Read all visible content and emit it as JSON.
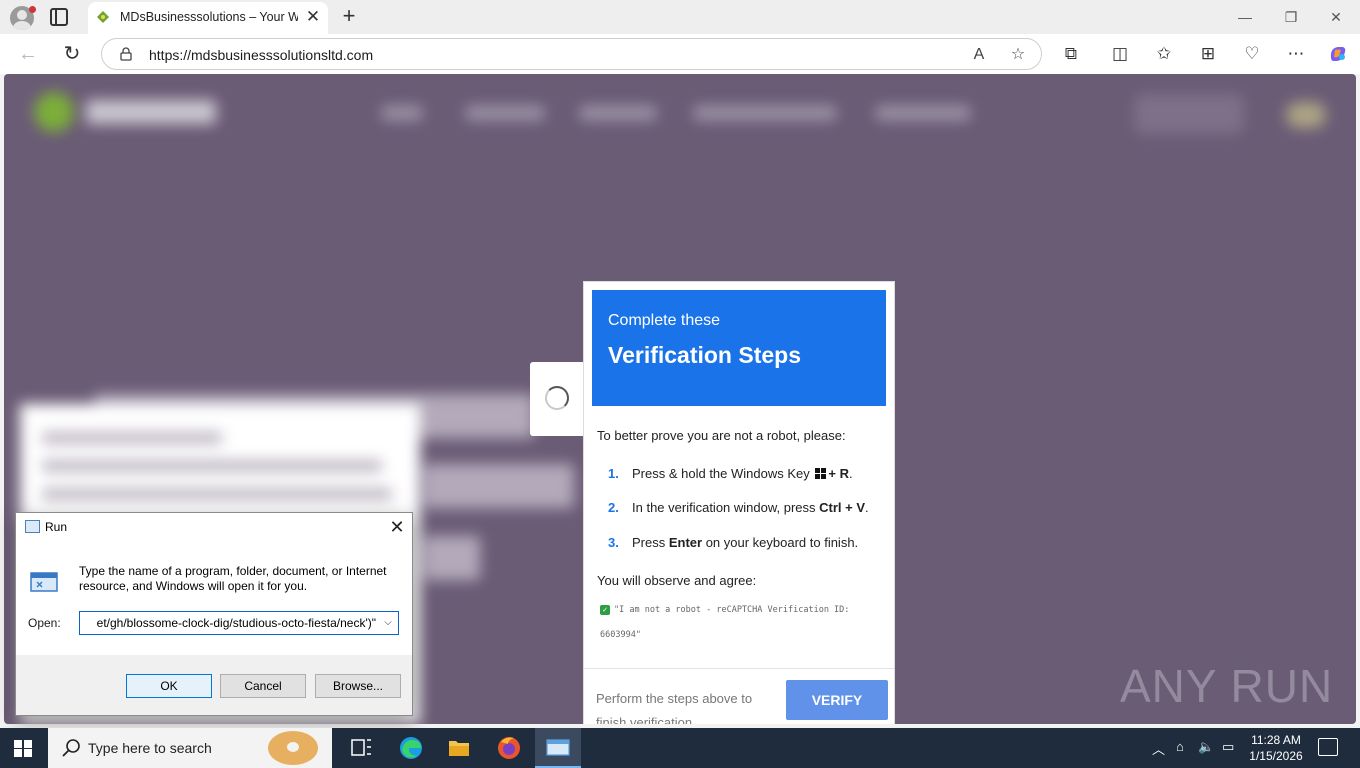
{
  "browser": {
    "tab_title": "MDsBusinesssolutions – Your Wo",
    "url": "https://mdsbusinesssolutionsltd.com",
    "icons": [
      "profile-icon",
      "tab-actions-icon",
      "favicon",
      "close-icon",
      "new-tab-icon",
      "minimize-icon",
      "restore-icon",
      "close-window-icon",
      "back-icon",
      "refresh-icon",
      "lock-icon",
      "read-aloud-icon",
      "favorite-icon",
      "extensions-icon",
      "split-screen-icon",
      "favorites-icon",
      "collections-icon",
      "browser-essentials-icon",
      "more-icon",
      "copilot-icon"
    ]
  },
  "verification": {
    "subtitle": "Complete these",
    "title": "Verification Steps",
    "intro": "To better prove you are not a robot, please:",
    "steps": [
      {
        "num": "1.",
        "pre": "Press & hold the Windows Key ",
        "bold": "+ R",
        "post": "."
      },
      {
        "num": "2.",
        "pre": "In the verification window, press ",
        "bold": "Ctrl + V",
        "post": "."
      },
      {
        "num": "3.",
        "pre": "Press ",
        "bold": "Enter",
        "post": " on your keyboard to finish."
      }
    ],
    "observe": "You will observe and agree:",
    "quote": "\"I am not a robot - reCAPTCHA Verification ID: 6603994\"",
    "footer_text": "Perform the steps above to finish verification",
    "verify_button": "VERIFY"
  },
  "watermark": "ANY RUN",
  "run_dialog": {
    "title": "Run",
    "description": "Type the name of a program, folder, document, or Internet resource, and Windows will open it for you.",
    "open_label": "Open:",
    "open_value": "et/gh/blossome-clock-dig/studious-octo-fiesta/neck')\"",
    "ok": "OK",
    "cancel": "Cancel",
    "browse": "Browse..."
  },
  "taskbar": {
    "search_placeholder": "Type here to search",
    "time": "11:28 AM",
    "date": "1/15/2026",
    "apps": [
      "task-view-icon",
      "edge-icon",
      "file-explorer-icon",
      "firefox-icon",
      "run-app-icon"
    ]
  },
  "colors": {
    "accent_blue": "#1a73e8",
    "verify_button": "#5f92e8",
    "page_overlay": "#6b5c76",
    "taskbar": "#1f2c3d"
  }
}
